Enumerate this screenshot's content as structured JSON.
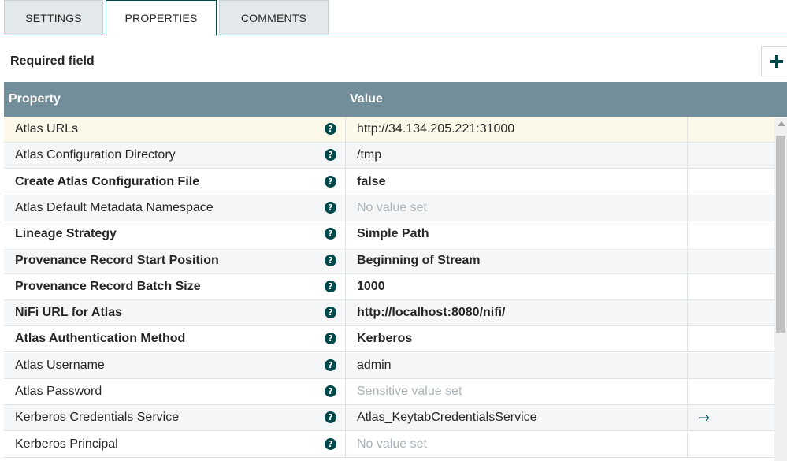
{
  "tabs": [
    {
      "label": "SETTINGS",
      "active": false
    },
    {
      "label": "PROPERTIES",
      "active": true
    },
    {
      "label": "COMMENTS",
      "active": false
    }
  ],
  "required_field_label": "Required field",
  "add_button_icon": "plus-icon",
  "table": {
    "headers": {
      "property": "Property",
      "value": "Value"
    },
    "rows": [
      {
        "name": "Atlas URLs",
        "required": false,
        "value": "http://34.134.205.221:31000",
        "value_style": "normal",
        "selected": true
      },
      {
        "name": "Atlas Configuration Directory",
        "required": false,
        "value": "/tmp",
        "value_style": "normal"
      },
      {
        "name": "Create Atlas Configuration File",
        "required": true,
        "value": "false",
        "value_style": "bold"
      },
      {
        "name": "Atlas Default Metadata Namespace",
        "required": false,
        "value": "No value set",
        "value_style": "unset"
      },
      {
        "name": "Lineage Strategy",
        "required": true,
        "value": "Simple Path",
        "value_style": "bold"
      },
      {
        "name": "Provenance Record Start Position",
        "required": true,
        "value": "Beginning of Stream",
        "value_style": "bold"
      },
      {
        "name": "Provenance Record Batch Size",
        "required": true,
        "value": "1000",
        "value_style": "bold"
      },
      {
        "name": "NiFi URL for Atlas",
        "required": true,
        "value": "http://localhost:8080/nifi/",
        "value_style": "bold"
      },
      {
        "name": "Atlas Authentication Method",
        "required": true,
        "value": "Kerberos",
        "value_style": "bold"
      },
      {
        "name": "Atlas Username",
        "required": false,
        "value": "admin",
        "value_style": "normal"
      },
      {
        "name": "Atlas Password",
        "required": false,
        "value": "Sensitive value set",
        "value_style": "unset"
      },
      {
        "name": "Kerberos Credentials Service",
        "required": false,
        "value": "Atlas_KeytabCredentialsService",
        "value_style": "normal",
        "action": "goto-arrow-icon"
      },
      {
        "name": "Kerberos Principal",
        "required": false,
        "value": "No value set",
        "value_style": "unset"
      }
    ]
  },
  "colors": {
    "header_bg": "#728e9b",
    "accent": "#004849",
    "selected_row": "#fdf9e8",
    "unset_text": "#aab3b7"
  }
}
